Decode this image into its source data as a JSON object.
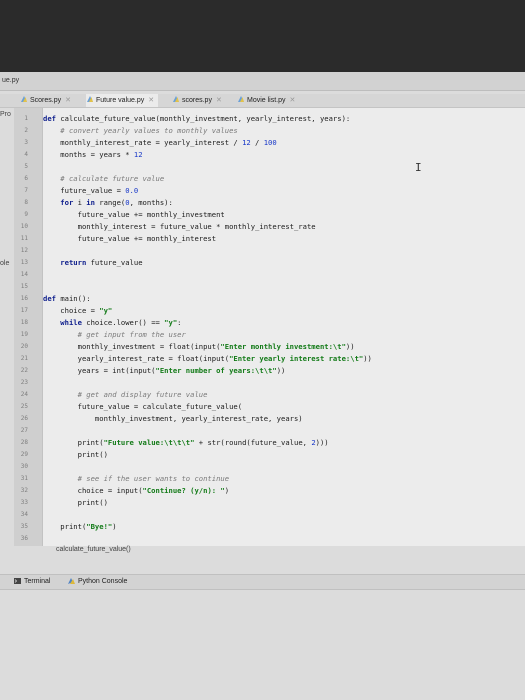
{
  "window": {
    "title": "ue.py"
  },
  "sidebar": {
    "project_label": "Pro",
    "console_label": "ole"
  },
  "tabs": [
    {
      "label": "Scores.py",
      "icon": "python-file-icon",
      "active": false
    },
    {
      "label": "Future value.py",
      "icon": "python-file-icon",
      "active": true
    },
    {
      "label": "scores.py",
      "icon": "python-file-icon",
      "active": false
    },
    {
      "label": "Movie list.py",
      "icon": "python-file-icon",
      "active": false
    }
  ],
  "editor": {
    "line_numbers": [
      "1",
      "2",
      "3",
      "4",
      "5",
      "6",
      "7",
      "8",
      "9",
      "10",
      "11",
      "12",
      "13",
      "14",
      "15",
      "16",
      "17",
      "18",
      "19",
      "20",
      "21",
      "22",
      "23",
      "24",
      "25",
      "26",
      "27",
      "28",
      "29",
      "30",
      "31",
      "32",
      "33",
      "34",
      "35",
      "36"
    ],
    "code": {
      "l1_kw": "def ",
      "l1_rest": "calculate_future_value(monthly_investment, yearly_interest, years):",
      "l2": "    # convert yearly values to monthly values",
      "l3_a": "    monthly_interest_rate = yearly_interest / ",
      "l3_n1": "12",
      "l3_b": " / ",
      "l3_n2": "100",
      "l4_a": "    months = years * ",
      "l4_n": "12",
      "l6": "    # calculate future value",
      "l7_a": "    future_value = ",
      "l7_n": "0.0",
      "l8_kw1": "    for ",
      "l8_a": "i ",
      "l8_kw2": "in ",
      "l8_b": "range(",
      "l8_n": "0",
      "l8_c": ", months):",
      "l9": "        future_value += monthly_investment",
      "l10": "        monthly_interest = future_value * monthly_interest_rate",
      "l11": "        future_value += monthly_interest",
      "l13_kw": "    return ",
      "l13_rest": "future_value",
      "l16_kw": "def ",
      "l16_rest": "main():",
      "l17_a": "    choice = ",
      "l17_s": "\"y\"",
      "l18_kw": "    while ",
      "l18_a": "choice.lower() == ",
      "l18_s": "\"y\"",
      "l18_b": ":",
      "l19": "        # get input from the user",
      "l20_a": "        monthly_investment = float(input(",
      "l20_s": "\"Enter monthly investment:\\t\"",
      "l20_b": "))",
      "l21_a": "        yearly_interest_rate = float(input(",
      "l21_s": "\"Enter yearly interest rate:\\t\"",
      "l21_b": "))",
      "l22_a": "        years = int(input(",
      "l22_s": "\"Enter number of years:\\t\\t\"",
      "l22_b": "))",
      "l24": "        # get and display future value",
      "l25": "        future_value = calculate_future_value(",
      "l26": "            monthly_investment, yearly_interest_rate, years)",
      "l28_a": "        print(",
      "l28_s": "\"Future value:\\t\\t\\t\"",
      "l28_b": " + str(round(future_value, ",
      "l28_n": "2",
      "l28_c": ")))",
      "l29": "        print()",
      "l31": "        # see if the user wants to continue",
      "l32_a": "        choice = input(",
      "l32_s": "\"Continue? (y/n): \"",
      "l32_b": ")",
      "l33": "        print()",
      "l35_a": "    print(",
      "l35_s": "\"Bye!\"",
      "l35_b": ")"
    },
    "breadcrumb": "calculate_future_value()"
  },
  "bottom_tabs": [
    {
      "label": "Terminal",
      "icon": "terminal-icon"
    },
    {
      "label": "Python Console",
      "icon": "python-console-icon"
    }
  ],
  "colors": {
    "keyword": "#0e1e8c",
    "string": "#127a17",
    "number": "#1838c8",
    "comment": "#7a7a7a"
  }
}
